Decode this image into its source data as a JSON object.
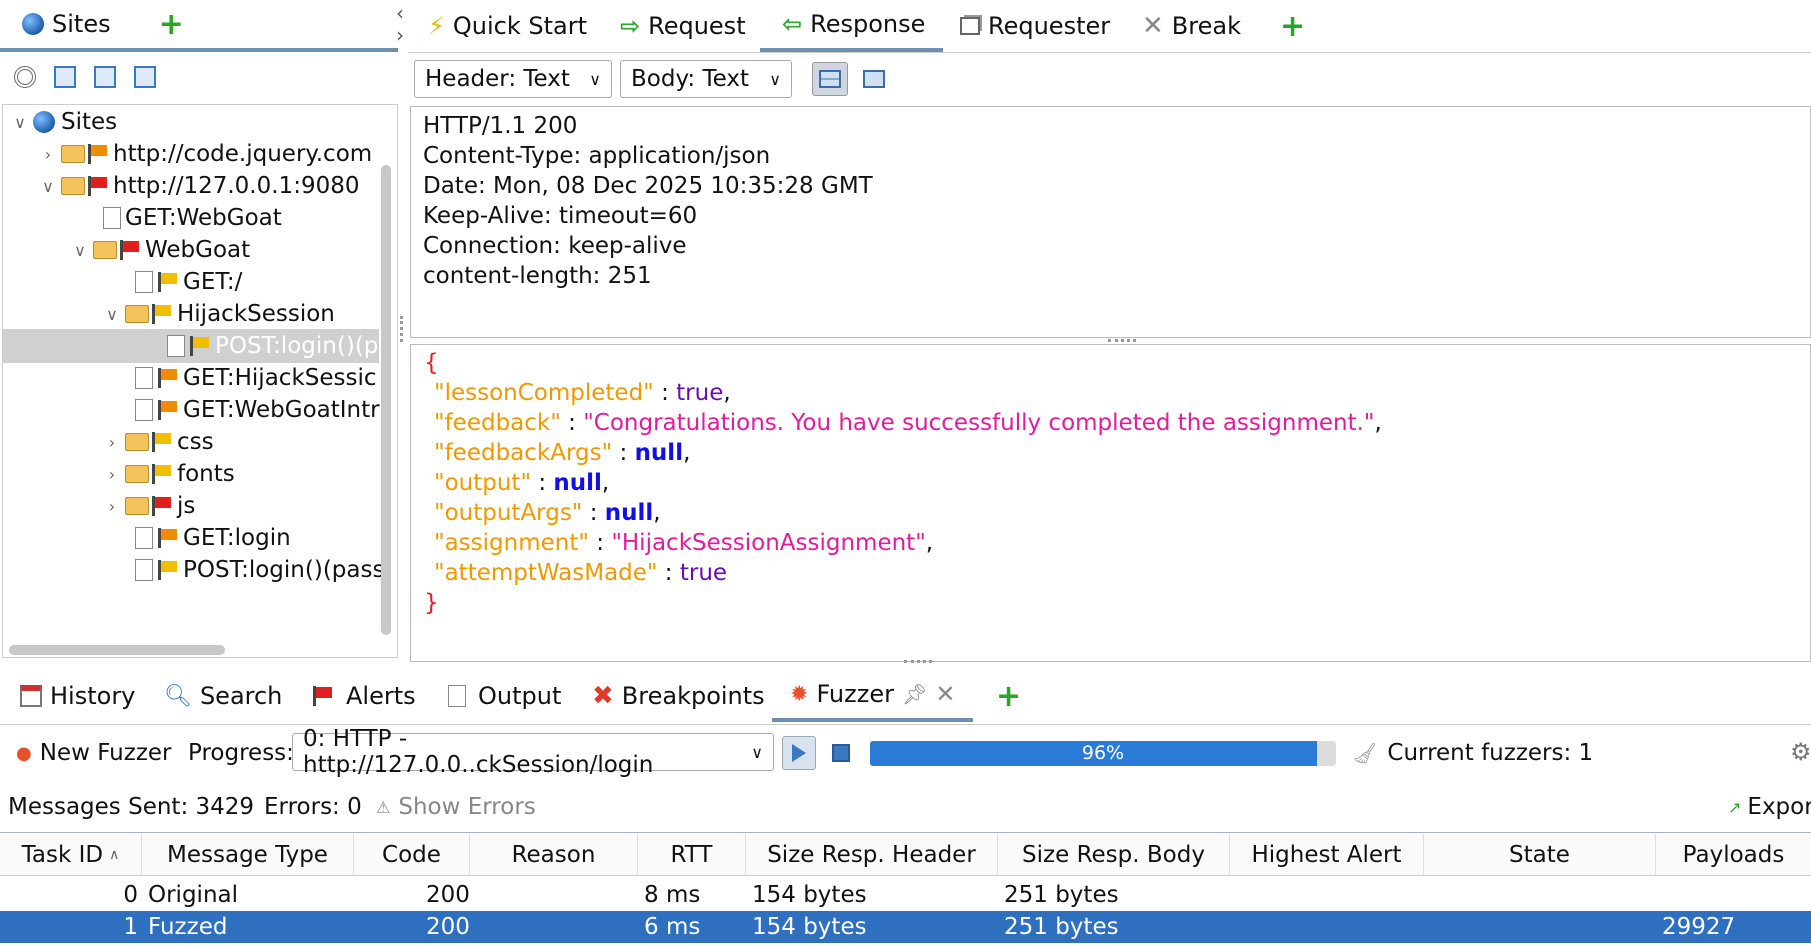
{
  "left_panel": {
    "tab_label": "Sites",
    "tree": {
      "root": "Sites",
      "items": [
        "http://code.jquery.com",
        "http://127.0.0.1:9080",
        "GET:WebGoat",
        "WebGoat",
        "GET:/",
        "HijackSession",
        "POST:login()(p",
        "GET:HijackSessic",
        "GET:WebGoatIntr",
        "css",
        "fonts",
        "js",
        "GET:login",
        "POST:login()(pass"
      ]
    }
  },
  "top_tabs": [
    {
      "label": "Quick Start",
      "icon": "lightning-icon"
    },
    {
      "label": "Request",
      "icon": "arrow-right-icon"
    },
    {
      "label": "Response",
      "icon": "arrow-left-icon",
      "active": true
    },
    {
      "label": "Requester",
      "icon": "requester-icon"
    },
    {
      "label": "Break",
      "icon": "break-icon"
    }
  ],
  "response_toolbar": {
    "header_view": "Header: Text",
    "body_view": "Body: Text"
  },
  "response_header": [
    "HTTP/1.1 200",
    "Content-Type: application/json",
    "Date: Mon, 08 Dec 2025 10:35:28 GMT",
    "Keep-Alive: timeout=60",
    "Connection: keep-alive",
    "content-length: 251"
  ],
  "response_body": {
    "open": "{",
    "close": "}",
    "fields": [
      {
        "key": "\"lessonCompleted\"",
        "sep": " : ",
        "value": "true",
        "kind": "t",
        "tail": ","
      },
      {
        "key": "\"feedback\"",
        "sep": " : ",
        "value": "\"Congratulations. You have successfully completed the assignment.\"",
        "kind": "s",
        "tail": ","
      },
      {
        "key": "\"feedbackArgs\"",
        "sep": " : ",
        "value": "null",
        "kind": "b",
        "tail": ","
      },
      {
        "key": "\"output\"",
        "sep": " : ",
        "value": "null",
        "kind": "b",
        "tail": ","
      },
      {
        "key": "\"outputArgs\"",
        "sep": " : ",
        "value": "null",
        "kind": "b",
        "tail": ","
      },
      {
        "key": "\"assignment\"",
        "sep": " : ",
        "value": "\"HijackSessionAssignment\"",
        "kind": "s",
        "tail": ","
      },
      {
        "key": "\"attemptWasMade\"",
        "sep": " : ",
        "value": "true",
        "kind": "t",
        "tail": ""
      }
    ]
  },
  "bottom_tabs": [
    {
      "label": "History",
      "icon": "calendar-icon"
    },
    {
      "label": "Search",
      "icon": "search-icon"
    },
    {
      "label": "Alerts",
      "icon": "flag-icon"
    },
    {
      "label": "Output",
      "icon": "document-icon"
    },
    {
      "label": "Breakpoints",
      "icon": "close-icon"
    },
    {
      "label": "Fuzzer",
      "icon": "fuzzer-icon",
      "active": true
    }
  ],
  "fuzzer": {
    "new_fuzzer": "New Fuzzer",
    "progress_label": "Progress:",
    "progress_select": "0: HTTP - http://127.0.0..ckSession/login",
    "progress_percent": "96%",
    "progress_value": 0.96,
    "current_fuzzers": "Current fuzzers: 1",
    "messages_sent": "Messages Sent: 3429",
    "errors": "Errors: 0",
    "show_errors": "Show Errors",
    "export": "Expor"
  },
  "table": {
    "columns": [
      "Task ID",
      "Message Type",
      "Code",
      "Reason",
      "RTT",
      "Size Resp. Header",
      "Size Resp. Body",
      "Highest Alert",
      "State",
      "Payloads"
    ],
    "rows": [
      {
        "task_id": "0",
        "message_type": "Original",
        "code": "200",
        "reason": "",
        "rtt": "8 ms",
        "size_header": "154 bytes",
        "size_body": "251 bytes",
        "highest_alert": "",
        "state": "",
        "payloads": ""
      },
      {
        "task_id": "1",
        "message_type": "Fuzzed",
        "code": "200",
        "reason": "",
        "rtt": "6 ms",
        "size_header": "154 bytes",
        "size_body": "251 bytes",
        "highest_alert": "",
        "state": "",
        "payloads": "29927"
      }
    ]
  },
  "colors": {
    "selection": "#2f6fbf",
    "progress_fill": "#2a7bd6",
    "tab_underline": "#6f8fb2"
  }
}
